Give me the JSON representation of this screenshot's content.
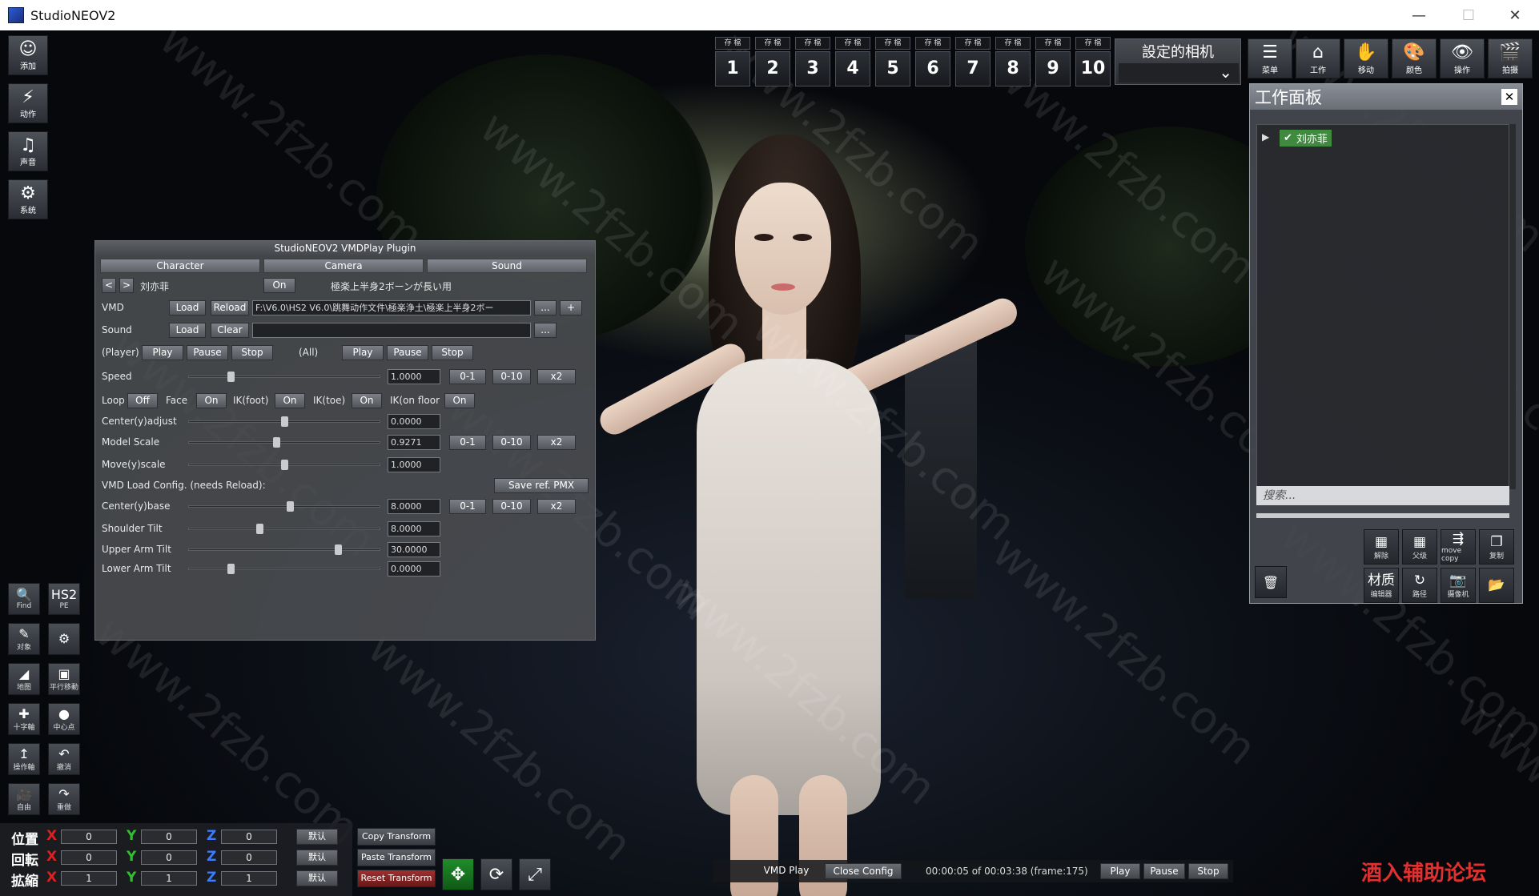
{
  "window": {
    "title": "StudioNEOV2",
    "min": "—",
    "max": "☐",
    "close": "✕"
  },
  "left_toolbar": [
    {
      "icon": "add-icon",
      "glyph": "☺",
      "label": "添加"
    },
    {
      "icon": "motion-icon",
      "glyph": "⚡",
      "label": "动作"
    },
    {
      "icon": "music-icon",
      "glyph": "♫",
      "label": "声音"
    },
    {
      "icon": "system-icon",
      "glyph": "⚙",
      "label": "系统"
    }
  ],
  "left_small": [
    {
      "icon": "find-icon",
      "glyph": "🔍",
      "label": "Find"
    },
    {
      "icon": "hs2pe-icon",
      "glyph": "HS2",
      "label": "PE"
    },
    {
      "icon": "object-icon",
      "glyph": "✎",
      "label": "对象"
    },
    {
      "icon": "settings-icon",
      "glyph": "⚙",
      "label": ""
    },
    {
      "icon": "ground-icon",
      "glyph": "◢",
      "label": "地图"
    },
    {
      "icon": "parallel-icon",
      "glyph": "▣",
      "label": "平行移動"
    },
    {
      "icon": "cross-axis-icon",
      "glyph": "✚",
      "label": "十字軸"
    },
    {
      "icon": "center-point-icon",
      "glyph": "●",
      "label": "中心点"
    },
    {
      "icon": "manip-axis-icon",
      "glyph": "↥",
      "label": "操作軸"
    },
    {
      "icon": "undo-icon",
      "glyph": "↶",
      "label": "撤消"
    },
    {
      "icon": "free-cam-icon",
      "glyph": "🎥",
      "label": "自由"
    },
    {
      "icon": "redo-icon",
      "glyph": "↷",
      "label": "重做"
    }
  ],
  "save_slots": {
    "header": "存 檔",
    "numbers": [
      "1",
      "2",
      "3",
      "4",
      "5",
      "6",
      "7",
      "8",
      "9",
      "10"
    ]
  },
  "camera_select": {
    "label": "設定的相机",
    "arrow": "⌄"
  },
  "top_tools": [
    {
      "icon": "menu-icon",
      "glyph": "☰",
      "label": "菜单"
    },
    {
      "icon": "work-icon",
      "glyph": "⌂",
      "label": "工作"
    },
    {
      "icon": "hand-icon",
      "glyph": "✋",
      "label": "移动"
    },
    {
      "icon": "palette-icon",
      "glyph": "🎨",
      "label": "颜色"
    },
    {
      "icon": "eye-icon",
      "glyph": "👁",
      "label": "操作"
    },
    {
      "icon": "clapper-icon",
      "glyph": "🎬",
      "label": "拍摄"
    }
  ],
  "workspace": {
    "title": "工作面板",
    "close": "✕",
    "node": "刘亦菲",
    "search": "搜索...",
    "buttons": [
      {
        "icon": "unlink-icon",
        "glyph": "▦",
        "label": "解除"
      },
      {
        "icon": "parent-icon",
        "glyph": "▦",
        "label": "父级"
      },
      {
        "icon": "move-copy-icon",
        "glyph": "⇶",
        "label": "move copy"
      },
      {
        "icon": "duplicate-icon",
        "glyph": "❐",
        "label": "复制"
      },
      {
        "icon": "material-editor-icon",
        "glyph": "材质",
        "label": "编辑器"
      },
      {
        "icon": "path-icon",
        "glyph": "↻",
        "label": "路径"
      },
      {
        "icon": "camera-icon",
        "glyph": "📷",
        "label": "摄像机"
      },
      {
        "icon": "folder-icon",
        "glyph": "📂",
        "label": ""
      }
    ],
    "trash": "🗑"
  },
  "vmd": {
    "title": "StudioNEOV2 VMDPlay Plugin",
    "tabs": [
      "Character",
      "Camera",
      "Sound"
    ],
    "prev": "<",
    "next": ">",
    "char_name": "刘亦菲",
    "on": "On",
    "note": "極楽上半身2ボーンが長い用",
    "vmd_label": "VMD",
    "load": "Load",
    "reload": "Reload",
    "vmd_path": "F:\\V6.0\\HS2 V6.0\\跳舞动作文件\\極楽浄土\\極楽上半身2ボー",
    "dots": "...",
    "plus": "+",
    "sound_label": "Sound",
    "clear": "Clear",
    "player_label": "(Player)",
    "all_label": "(All)",
    "play": "Play",
    "pause": "Pause",
    "stop": "Stop",
    "speed_label": "Speed",
    "speed": "1.0000",
    "r01": "0-1",
    "r010": "0-10",
    "x2": "x2",
    "loop_label": "Loop",
    "off": "Off",
    "face_label": "Face",
    "ikfoot_label": "IK(foot)",
    "iktoe_label": "IK(toe)",
    "ikfloor_label": "IK(on floor",
    "center_adjust_label": "Center(y)adjust",
    "center_adjust": "0.0000",
    "model_scale_label": "Model Scale",
    "model_scale": "0.9271",
    "move_scale_label": "Move(y)scale",
    "move_scale": "1.0000",
    "config_label": "VMD Load Config. (needs Reload):",
    "save_pmx": "Save ref. PMX",
    "center_base_label": "Center(y)base",
    "center_base": "8.0000",
    "shoulder_label": "Shoulder Tilt",
    "shoulder": "8.0000",
    "upper_arm_label": "Upper Arm Tilt",
    "upper_arm": "30.0000",
    "lower_arm_label": "Lower Arm Tilt",
    "lower_arm": "0.0000",
    "sliders": {
      "speed": 0.22,
      "center_adjust": 0.5,
      "model_scale": 0.46,
      "move_scale": 0.5,
      "center_base": 0.53,
      "shoulder": 0.37,
      "upper_arm": 0.78,
      "lower_arm": 0.22
    }
  },
  "transform": {
    "pos_label": "位置",
    "rot_label": "回転",
    "scale_label": "拡縮",
    "x": "X",
    "y": "Y",
    "z": "Z",
    "pos": [
      "0",
      "0",
      "0"
    ],
    "rot": [
      "0",
      "0",
      "0"
    ],
    "scale": [
      "1",
      "1",
      "1"
    ],
    "default": "默认",
    "copy": "Copy Transform",
    "paste": "Paste Transform",
    "reset": "Reset Transform"
  },
  "gizmos": [
    {
      "icon": "move-gizmo-icon",
      "glyph": "✥"
    },
    {
      "icon": "rotate-gizmo-icon",
      "glyph": "⟳"
    },
    {
      "icon": "scale-gizmo-icon",
      "glyph": "⤢"
    }
  ],
  "playback": {
    "vmd_play": "VMD Play",
    "close_config": "Close Config",
    "time": "00:00:05 of 00:03:38  (frame:175)",
    "play": "Play",
    "pause": "Pause",
    "stop": "Stop"
  },
  "watermark": "www.2fzb.com",
  "corner_brand": "酒入辅助论坛",
  "colors": {
    "accent": "#3f8a3e",
    "red": "#e02020",
    "green": "#2fc12f",
    "blue": "#3b7bff"
  }
}
